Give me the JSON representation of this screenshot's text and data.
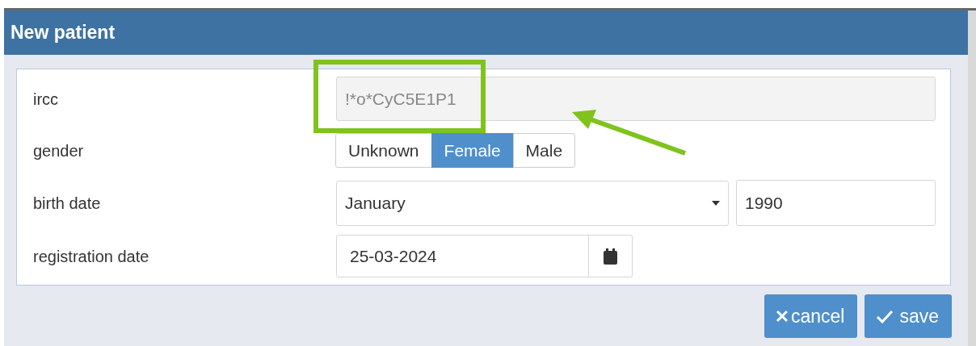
{
  "dialog": {
    "title": "New patient"
  },
  "fields": [
    {
      "kind": "text",
      "label": "ircc",
      "value": "!*o*CyC5E1P1",
      "disabled": true
    },
    {
      "kind": "segmented",
      "label": "gender",
      "options": [
        {
          "label": "Unknown",
          "selected": false
        },
        {
          "label": "Female",
          "selected": true
        },
        {
          "label": "Male",
          "selected": false
        }
      ]
    },
    {
      "kind": "month-year",
      "label": "birth date",
      "month": "January",
      "year": "1990"
    },
    {
      "kind": "date",
      "label": "registration date",
      "value": "25-03-2024"
    }
  ],
  "buttons": [
    {
      "kind": "cancel",
      "label": "cancel"
    },
    {
      "kind": "save",
      "label": "save"
    }
  ]
}
